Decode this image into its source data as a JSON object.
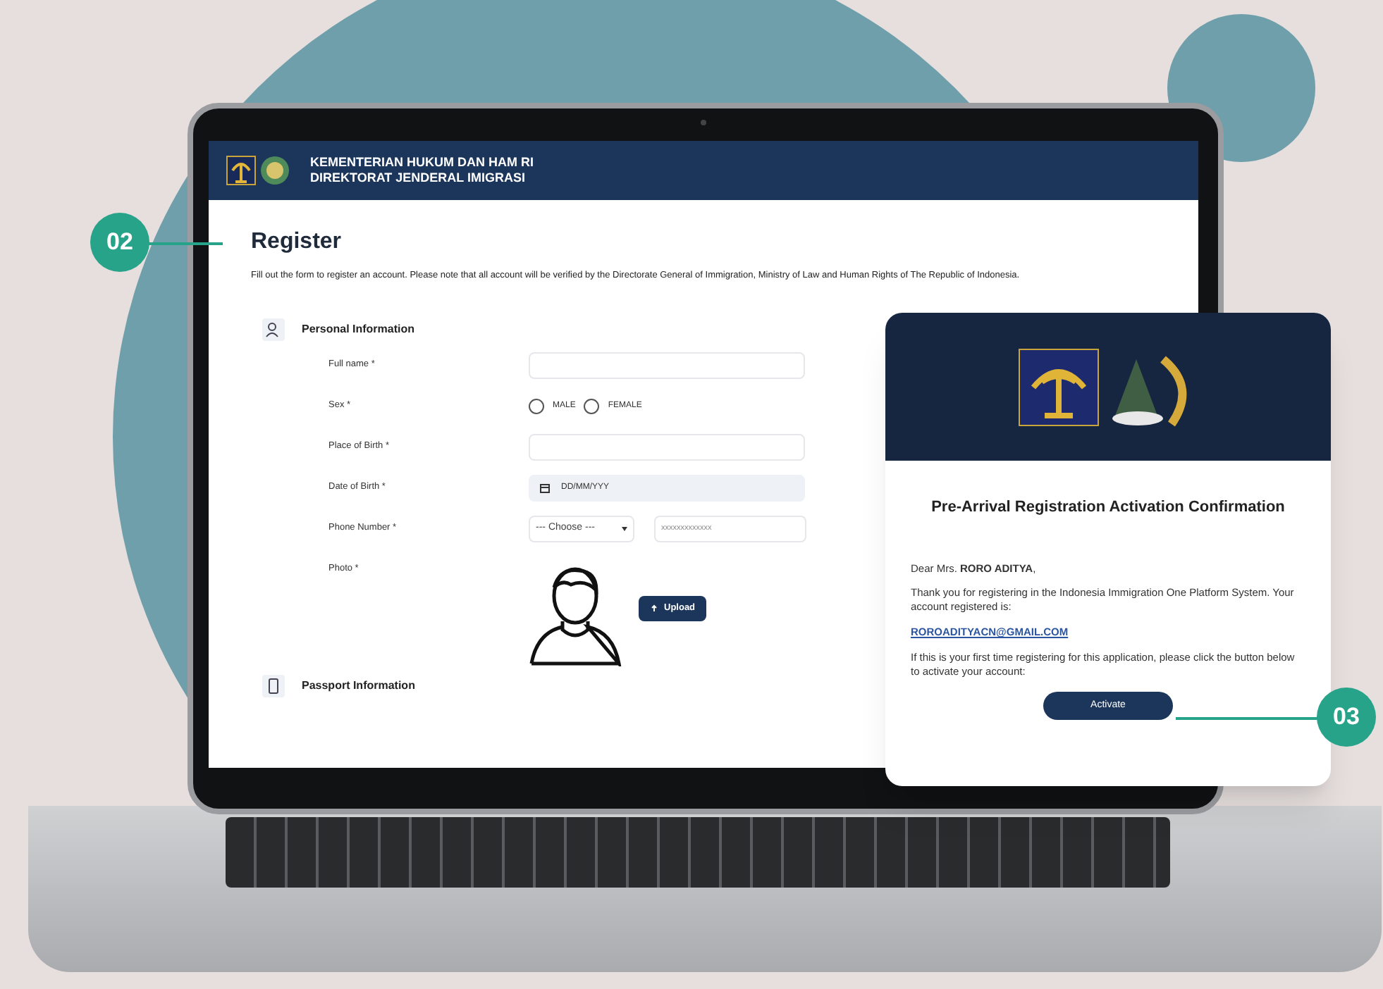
{
  "header": {
    "line_1": "KEMENTERIAN HUKUM DAN HAM RI",
    "line_2": "DIREKTORAT JENDERAL IMIGRASI"
  },
  "register": {
    "title": "Register",
    "intro": "Fill out the form to register an account. Please note that all account will be verified by the Directorate General of Immigration, Ministry of Law and Human Rights of The Republic of Indonesia."
  },
  "personal_information": {
    "title": "Personal Information",
    "fields": [
      {
        "kind": "text",
        "label": "Full name *"
      },
      {
        "kind": "radio",
        "label": "Sex *",
        "options": [
          {
            "label": "MALE",
            "selected": false
          },
          {
            "label": "FEMALE",
            "selected": false
          }
        ]
      },
      {
        "kind": "text",
        "label": "Place of Birth *"
      },
      {
        "kind": "date",
        "label": "Date of Birth *",
        "placeholder": "DD/MM/YYY"
      },
      {
        "kind": "phone",
        "label": "Phone Number *",
        "select": "--- Choose ---",
        "placeholder": "xxxxxxxxxxxxx"
      },
      {
        "kind": "photo",
        "label": "Photo *",
        "button": "Upload"
      }
    ]
  },
  "passport_information": {
    "title": "Passport Information"
  },
  "email_card": {
    "title": "Pre-Arrival Registration Activation Confirmation",
    "greeting": "Dear Mrs. **RORO ADITYA**,",
    "body": "Thank you for registering in the Indonesia Immigration One Platform System. Your account registered is:",
    "email": "ROROADITYACN@GMAIL.COM",
    "note": "If this is your first time registering for this application, please click the button below to activate your account:",
    "button": "Activate"
  },
  "callouts": [
    "02",
    "03"
  ]
}
